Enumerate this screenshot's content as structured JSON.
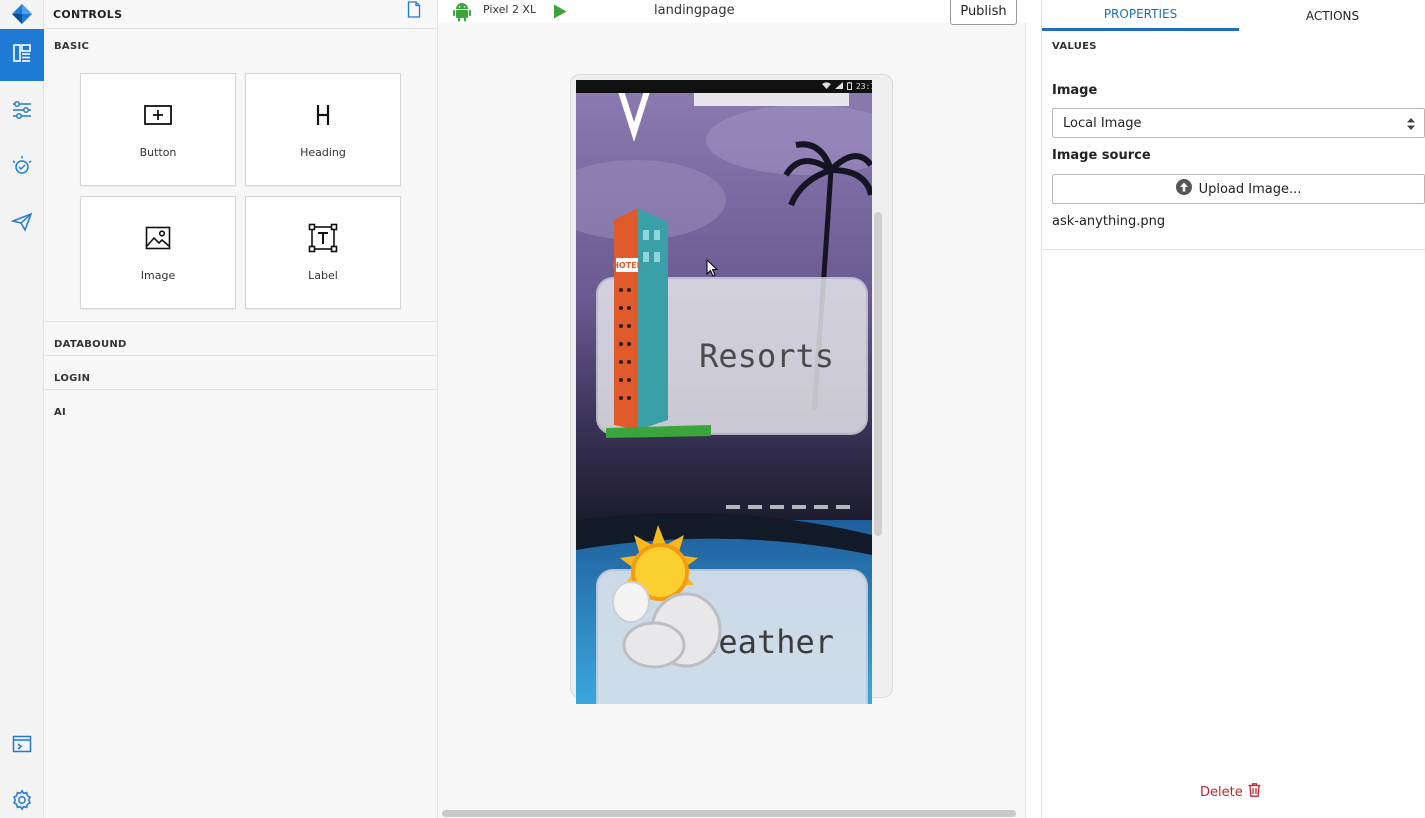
{
  "controls": {
    "title": "CONTROLS",
    "basic_label": "BASIC",
    "tiles": [
      {
        "label": "Button",
        "icon": "button-add-icon"
      },
      {
        "label": "Heading",
        "icon": "heading-icon"
      },
      {
        "label": "Image",
        "icon": "image-icon"
      },
      {
        "label": "Label",
        "icon": "label-text-icon"
      }
    ],
    "sections": [
      "DATABOUND",
      "LOGIN",
      "AI"
    ]
  },
  "toolbar": {
    "device": "Pixel 2 XL",
    "page_name": "landingpage",
    "publish_label": "Publish"
  },
  "phone": {
    "clock": "23:18",
    "cards": [
      "Resorts",
      "Weather"
    ],
    "hotel_sign": "HOTEL"
  },
  "properties": {
    "tab_properties": "PROPERTIES",
    "tab_actions": "ACTIONS",
    "values_label": "VALUES",
    "image_label": "Image",
    "image_select_value": "Local Image",
    "source_label": "Image source",
    "upload_label": "Upload Image...",
    "filename": "ask-anything.png",
    "delete_label": "Delete"
  },
  "colors": {
    "accent": "#1f7ad3",
    "delete": "#c1272d",
    "android_green": "#3aa53a"
  }
}
